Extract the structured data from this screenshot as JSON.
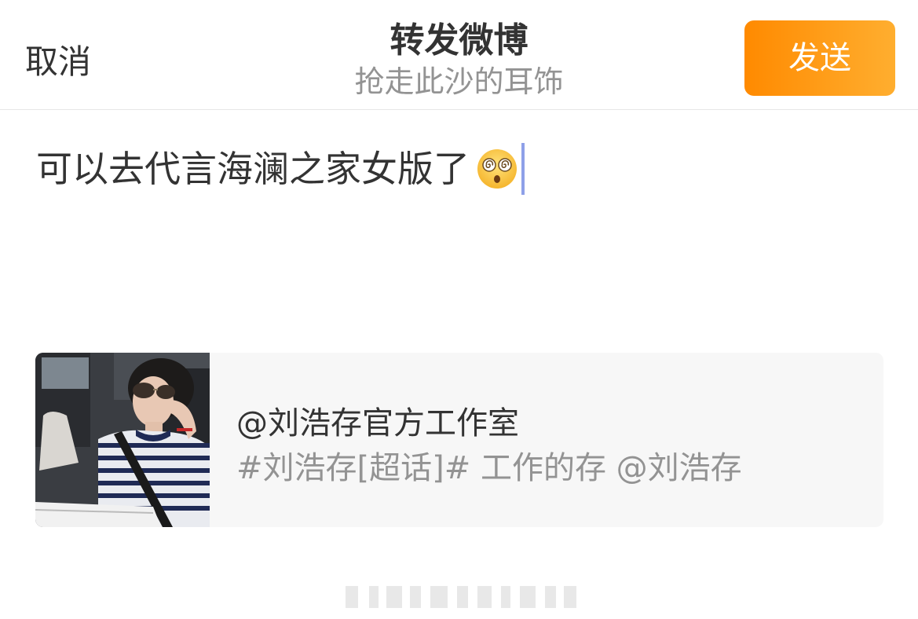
{
  "nav": {
    "cancel_label": "取消",
    "title": "转发微博",
    "subtitle": "抢走此沙的耳饰",
    "send_label": "发送"
  },
  "editor": {
    "text": "可以去代言海澜之家女版了",
    "emoji": "dizzy-face-emoji"
  },
  "quoted_post": {
    "author": "@刘浩存官方工作室",
    "text": "#刘浩存[超话]# 工作的存 @刘浩存"
  },
  "colors": {
    "send_gradient_start": "#ff8a00",
    "send_gradient_end": "#ffae2f",
    "caret": "#8ea0e8",
    "card_bg": "#f7f7f7",
    "muted_text": "#939393",
    "primary_text": "#333333"
  }
}
